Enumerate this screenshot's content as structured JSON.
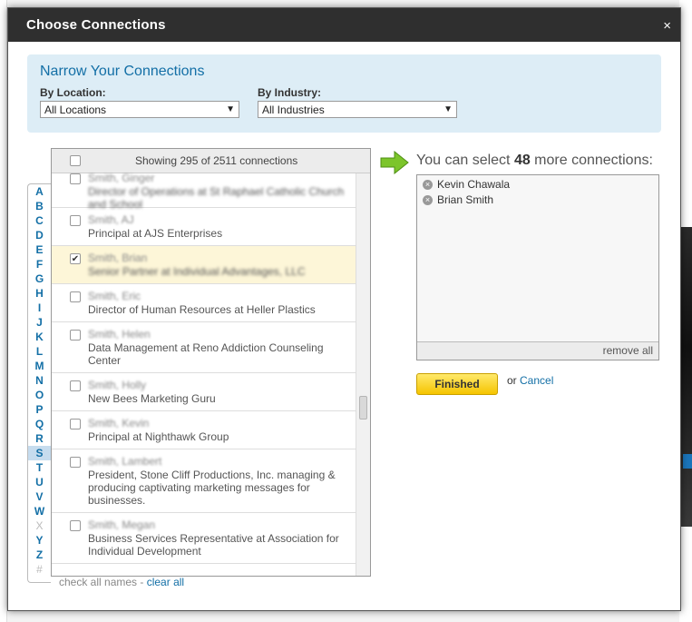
{
  "modal": {
    "title": "Choose Connections",
    "close_label": "×"
  },
  "narrow": {
    "title": "Narrow Your Connections",
    "location_label": "By Location:",
    "location_value": "All Locations",
    "industry_label": "By Industry:",
    "industry_value": "All Industries"
  },
  "list": {
    "header_text": "Showing 295 of 2511 connections",
    "rows": [
      {
        "name": "Smith, Ginger",
        "title": "Director of Operations at St Raphael Catholic Church and School",
        "checked": false
      },
      {
        "name": "Smith, AJ",
        "title": "Principal at AJS Enterprises",
        "checked": false
      },
      {
        "name": "Smith, Brian",
        "title": "Senior Partner at Individual Advantages, LLC",
        "checked": true
      },
      {
        "name": "Smith, Eric",
        "title": "Director of Human Resources at Heller Plastics",
        "checked": false
      },
      {
        "name": "Smith, Helen",
        "title": "Data Management at Reno Addiction Counseling Center",
        "checked": false
      },
      {
        "name": "Smith, Holly",
        "title": "New Bees Marketing Guru",
        "checked": false
      },
      {
        "name": "Smith, Kevin",
        "title": "Principal at Nighthawk Group",
        "checked": false
      },
      {
        "name": "Smith, Lambert",
        "title": "President, Stone Cliff Productions, Inc. managing & producing captivating marketing messages for businesses.",
        "checked": false
      },
      {
        "name": "Smith, Megan",
        "title": "Business Services Representative at Association for Individual Development",
        "checked": false
      }
    ],
    "check_all_label": "check all names",
    "separator": " - ",
    "clear_all_label": "clear all"
  },
  "alphabet": {
    "letters": [
      "A",
      "B",
      "C",
      "D",
      "E",
      "F",
      "G",
      "H",
      "I",
      "J",
      "K",
      "L",
      "M",
      "N",
      "O",
      "P",
      "Q",
      "R",
      "S",
      "T",
      "U",
      "V",
      "W",
      "X",
      "Y",
      "Z",
      "#"
    ],
    "disabled": [
      "X",
      "#"
    ],
    "active": "S"
  },
  "selected": {
    "prefix": "You can select ",
    "count": "48",
    "suffix": " more connections:",
    "items": [
      "Kevin Chawala",
      "Brian Smith"
    ],
    "remove_all_label": "remove all"
  },
  "actions": {
    "finished_label": "Finished",
    "or_label": "or ",
    "cancel_label": "Cancel"
  },
  "colors": {
    "header_bg": "#2f2f2f",
    "link": "#136fa6",
    "panel_bg": "#ddedf6",
    "finished_bg": "#f5c400",
    "arrow_green": "#7cc52b"
  }
}
